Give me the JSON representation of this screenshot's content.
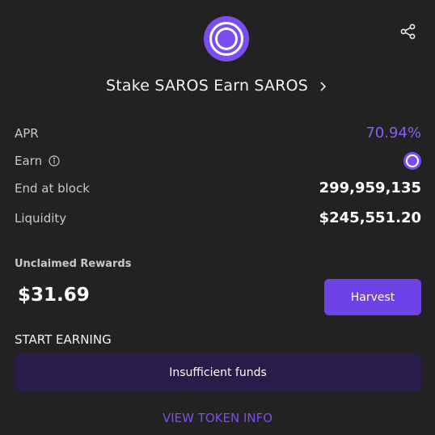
{
  "header": {
    "title": "Stake SAROS Earn SAROS"
  },
  "stats": {
    "apr_label": "APR",
    "apr_value": "70.94%",
    "earn_label": "Earn",
    "end_block_label": "End at block",
    "end_block_value": "299,959,135",
    "liquidity_label": "Liquidity",
    "liquidity_value": "$245,551.20"
  },
  "rewards": {
    "label": "Unclaimed Rewards",
    "value": "$31.69",
    "harvest_label": "Harvest"
  },
  "earning": {
    "label": "START EARNING",
    "button_label": "Insufficient funds"
  },
  "footer": {
    "link_label": "VIEW TOKEN INFO"
  },
  "icons": {
    "share": "share-icon",
    "logo": "saros-logo",
    "chevron": "chevron-right-icon",
    "info": "info-icon",
    "earn_token": "saros-token-icon"
  },
  "colors": {
    "background": "#232222",
    "accent": "#7b4df0",
    "apr": "#8a5cf6",
    "harvest_button": "#6f42e8",
    "disabled_button": "#2a1c4a"
  }
}
